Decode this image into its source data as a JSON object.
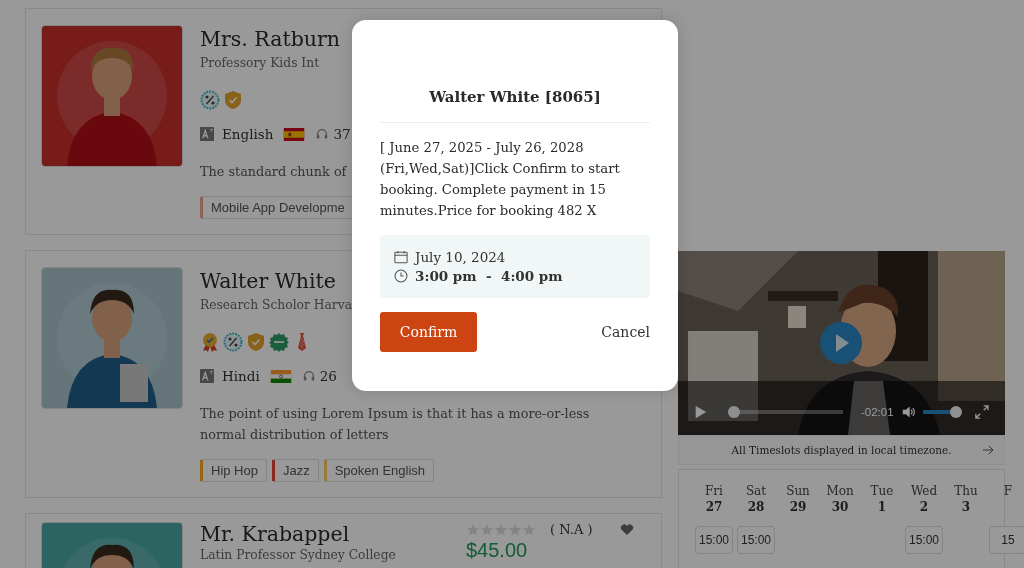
{
  "tutors": [
    {
      "name": "Mrs. Ratburn",
      "subtitle": "Professory Kids Int",
      "badges": [
        {
          "kind": "percent"
        },
        {
          "kind": "shield"
        }
      ],
      "language": "English",
      "language_flag": {
        "kind": "spain"
      },
      "count": "37",
      "description": "The standard chunk of",
      "tags": [
        {
          "label": "Mobile App Developme",
          "color": "#8d6157"
        }
      ]
    },
    {
      "name": "Walter White",
      "subtitle": "Research Scholor Harva",
      "badges": [
        {
          "kind": "medal"
        },
        {
          "kind": "percent"
        },
        {
          "kind": "shield"
        },
        {
          "kind": "seal"
        },
        {
          "kind": "tie"
        }
      ],
      "language": "Hindi",
      "language_flag": {
        "kind": "india"
      },
      "count": "26",
      "description": "The point of using Lorem Ipsum is that it has a more-or-less normal distribution of letters",
      "tags": [
        {
          "label": "Hip Hop",
          "color": "#976514"
        },
        {
          "label": "Jazz",
          "color": "#8d281e"
        },
        {
          "label": "Spoken English",
          "color": "#97793c"
        }
      ]
    },
    {
      "name": "Mr. Krabappel",
      "subtitle": "Latin Professor Sydney College",
      "stars": 0,
      "rating": "( N.A )",
      "price": "$45.00"
    }
  ],
  "video": {
    "time": "-02:01",
    "progress": {
      "level": 0.0
    },
    "volume": {
      "level": 0.85
    }
  },
  "timezone_note": "All Timeslots displayed in local timezone.",
  "calendar": [
    {
      "day": "Fri",
      "date": "27",
      "slots": [
        "15:00"
      ]
    },
    {
      "day": "Sat",
      "date": "28",
      "slots": [
        "15:00"
      ]
    },
    {
      "day": "Sun",
      "date": "29"
    },
    {
      "day": "Mon",
      "date": "30"
    },
    {
      "day": "Tue",
      "date": "1"
    },
    {
      "day": "Wed",
      "date": "2",
      "slots": [
        "15:00"
      ]
    },
    {
      "day": "Thu",
      "date": "3"
    },
    {
      "day": "F",
      "slots": [
        "15"
      ]
    }
  ],
  "modal": {
    "title": "Walter White [8065]",
    "message": "[ June 27, 2025 - July 26, 2028 (Fri,Wed,Sat)]Click Confirm to start booking. Complete payment in 15 minutes.Price for booking 482 X",
    "date": "July 10, 2024",
    "time": "3:00 pm  -  4:00 pm",
    "confirm": "Confirm",
    "cancel": "Cancel"
  }
}
